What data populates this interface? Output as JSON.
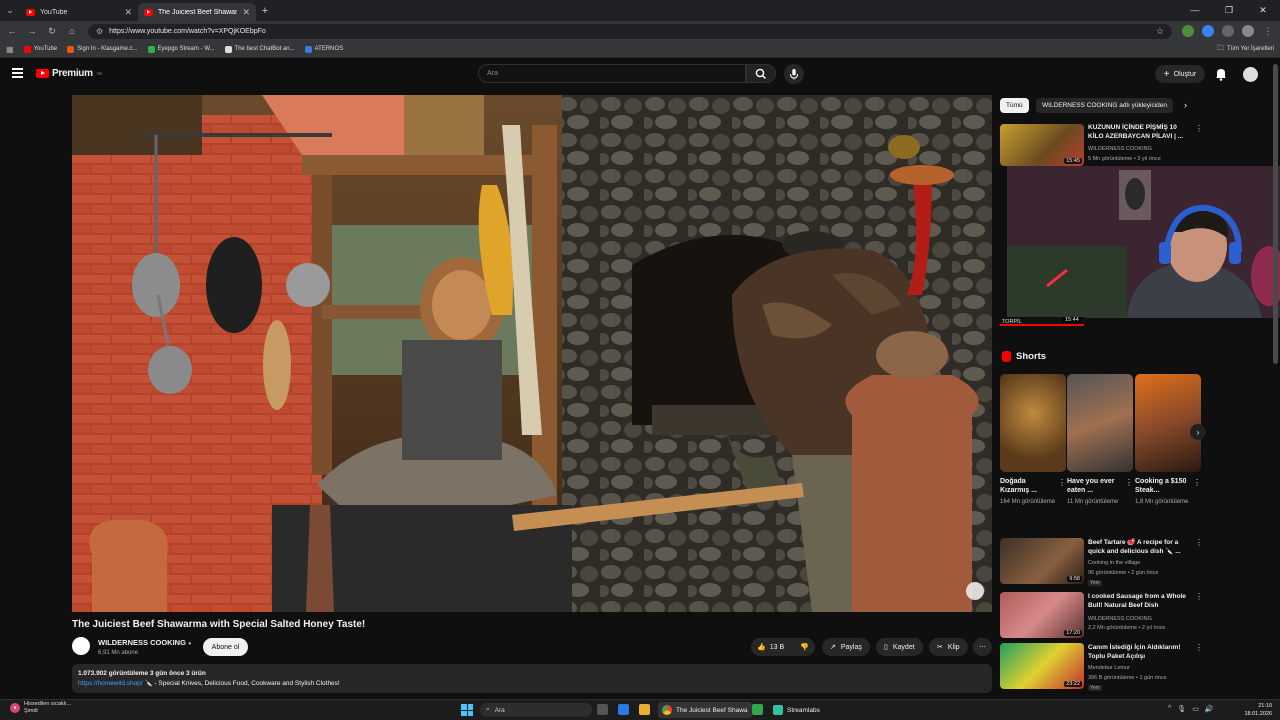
{
  "browser": {
    "tabs": [
      {
        "title": "YouTube",
        "active": false
      },
      {
        "title": "The Juiciest Beef Shawarma",
        "active": true
      }
    ],
    "url": "https://www.youtube.com/watch?v=XPQjKOEbpFo",
    "bookmarks": [
      {
        "label": "YouTube",
        "color": "#ff0000"
      },
      {
        "label": "Sign In - Klasgame.c...",
        "color": "#e8590c"
      },
      {
        "label": "Eyepgo Stream - W...",
        "color": "#2fb344"
      },
      {
        "label": "The best ChatBot an...",
        "color": "#dddddd"
      },
      {
        "label": "ATERNOS",
        "color": "#3b7dd8"
      }
    ],
    "bookmarks_all": "Tüm Yer İşaretleri"
  },
  "masthead": {
    "logo_text": "Premium",
    "logo_sup": "TR",
    "search_placeholder": "Ara",
    "create_label": "Oluştur"
  },
  "video": {
    "title": "The Juiciest Beef Shawarma with Special Salted Honey Taste!",
    "channel": "WILDERNESS COOKING",
    "subscribers": "6,91 Mn abone",
    "subscribe_label": "Abone ol",
    "likes": "13 B",
    "share_label": "Paylaş",
    "save_label": "Kaydet",
    "clip_label": "Klip",
    "stats": "1.073.902 görüntüleme  3 gün önce  3 ürün",
    "desc_link": "https://homewild.shop/",
    "desc_text": " 🔪 - Special Knives, Delicious Food, Cookware and Stylish Clothes!"
  },
  "sidebar": {
    "chips": [
      "Tümü",
      "WILDERNESS COOKING adlı yükleyiciden"
    ],
    "top_video": {
      "title": "KUZUNUN İÇİNDE PİŞMİŞ 10 KİLO AZERBAYCAN PİLAVI | ...",
      "channel": "WILDERNESS COOKING",
      "meta": "5 Mn görüntüleme • 3 yıl önce",
      "duration": "15:45"
    },
    "torpil": {
      "label": "TORPİL",
      "duration": "15:44"
    },
    "shorts_heading": "Shorts",
    "shorts": [
      {
        "title": "Doğada Kızarmış ...",
        "views": "164 Mn görüntüleme"
      },
      {
        "title": "Have you ever eaten ...",
        "views": "11 Mn görüntüleme"
      },
      {
        "title": "Cooking a $150 Steak...",
        "views": "1,8 Mn görüntüleme"
      }
    ],
    "videos": [
      {
        "title": "Beef Tartare 🥩 A recipe for a quick and delicious dish 🔪 ...",
        "channel": "Cooking in the village",
        "meta": "96 görüntüleme • 2 gün önce",
        "badge": "Yeni",
        "duration": "9:58"
      },
      {
        "title": "I cooked Sausage from a Whole Bull! Natural Beef Dish",
        "channel": "WILDERNESS COOKING",
        "meta": "2,2 Mn görüntüleme • 2 yıl önce",
        "badge": "",
        "duration": "17:20"
      },
      {
        "title": "Canım İstediği İçin Aldıklarım! Toplu Paket Açılışı",
        "channel": "Mendebur Lemur",
        "meta": "396 B görüntüleme • 1 gün önce",
        "badge": "Yeni",
        "duration": "23:22"
      }
    ]
  },
  "taskbar": {
    "weather_line1": "Hissedilen sıcaklı...",
    "weather_line2": "Şimdi",
    "search_label": "Ara",
    "chrome_label": "The Juiciest Beef Shawa",
    "streamlabs_label": "Streamlabs",
    "time": "21:10",
    "date": "18.01.2026"
  }
}
